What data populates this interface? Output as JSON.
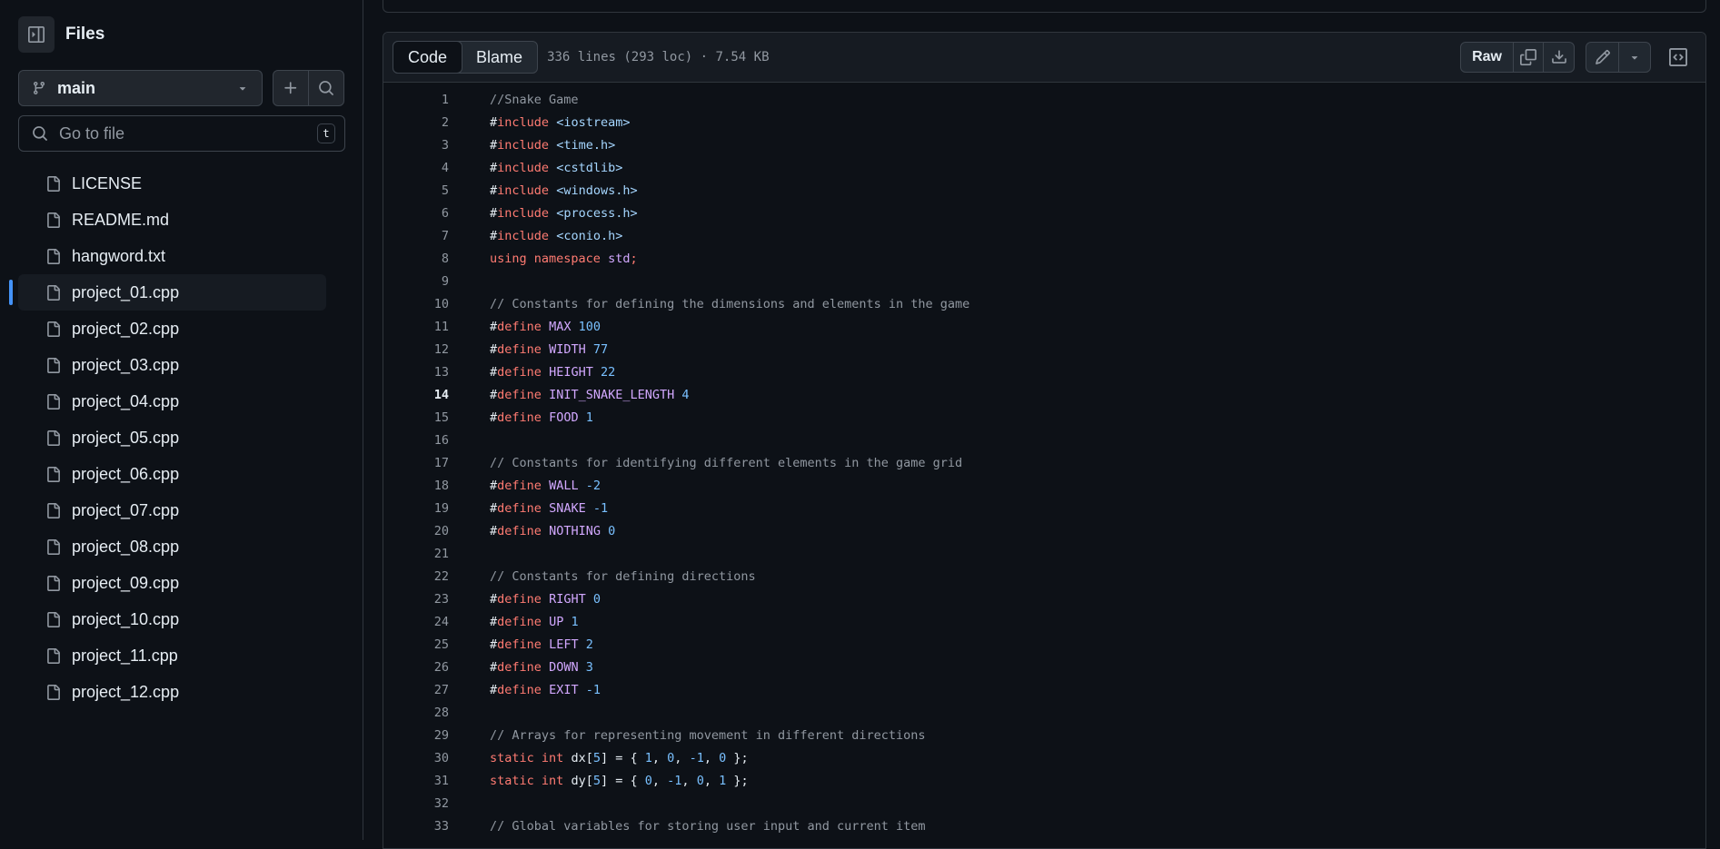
{
  "sidebar": {
    "title": "Files",
    "branch": "main",
    "search_placeholder": "Go to file",
    "search_shortcut": "t",
    "files": [
      {
        "name": "LICENSE",
        "active": false
      },
      {
        "name": "README.md",
        "active": false
      },
      {
        "name": "hangword.txt",
        "active": false
      },
      {
        "name": "project_01.cpp",
        "active": true
      },
      {
        "name": "project_02.cpp",
        "active": false
      },
      {
        "name": "project_03.cpp",
        "active": false
      },
      {
        "name": "project_04.cpp",
        "active": false
      },
      {
        "name": "project_05.cpp",
        "active": false
      },
      {
        "name": "project_06.cpp",
        "active": false
      },
      {
        "name": "project_07.cpp",
        "active": false
      },
      {
        "name": "project_08.cpp",
        "active": false
      },
      {
        "name": "project_09.cpp",
        "active": false
      },
      {
        "name": "project_10.cpp",
        "active": false
      },
      {
        "name": "project_11.cpp",
        "active": false
      },
      {
        "name": "project_12.cpp",
        "active": false
      }
    ]
  },
  "code_view": {
    "tabs": [
      {
        "label": "Code",
        "active": true
      },
      {
        "label": "Blame",
        "active": false
      }
    ],
    "file_meta": "336 lines (293 loc) · 7.54 KB",
    "raw_label": "Raw",
    "highlighted_line": 14,
    "lines": [
      [
        [
          "c",
          "//Snake Game"
        ]
      ],
      [
        [
          "t",
          "#"
        ],
        [
          "k",
          "include"
        ],
        [
          "t",
          " "
        ],
        [
          "s",
          "<iostream>"
        ]
      ],
      [
        [
          "t",
          "#"
        ],
        [
          "k",
          "include"
        ],
        [
          "t",
          " "
        ],
        [
          "s",
          "<time.h>"
        ]
      ],
      [
        [
          "t",
          "#"
        ],
        [
          "k",
          "include"
        ],
        [
          "t",
          " "
        ],
        [
          "s",
          "<cstdlib>"
        ]
      ],
      [
        [
          "t",
          "#"
        ],
        [
          "k",
          "include"
        ],
        [
          "t",
          " "
        ],
        [
          "s",
          "<windows.h>"
        ]
      ],
      [
        [
          "t",
          "#"
        ],
        [
          "k",
          "include"
        ],
        [
          "t",
          " "
        ],
        [
          "s",
          "<process.h>"
        ]
      ],
      [
        [
          "t",
          "#"
        ],
        [
          "k",
          "include"
        ],
        [
          "t",
          " "
        ],
        [
          "s",
          "<conio.h>"
        ]
      ],
      [
        [
          "k",
          "using"
        ],
        [
          "t",
          " "
        ],
        [
          "k",
          "namespace"
        ],
        [
          "t",
          " "
        ],
        [
          "m",
          "std"
        ],
        [
          "k",
          ";"
        ]
      ],
      [],
      [
        [
          "c",
          "// Constants for defining the dimensions and elements in the game"
        ]
      ],
      [
        [
          "t",
          "#"
        ],
        [
          "k",
          "define"
        ],
        [
          "t",
          " "
        ],
        [
          "m",
          "MAX"
        ],
        [
          "t",
          " "
        ],
        [
          "n",
          "100"
        ]
      ],
      [
        [
          "t",
          "#"
        ],
        [
          "k",
          "define"
        ],
        [
          "t",
          " "
        ],
        [
          "m",
          "WIDTH"
        ],
        [
          "t",
          " "
        ],
        [
          "n",
          "77"
        ]
      ],
      [
        [
          "t",
          "#"
        ],
        [
          "k",
          "define"
        ],
        [
          "t",
          " "
        ],
        [
          "m",
          "HEIGHT"
        ],
        [
          "t",
          " "
        ],
        [
          "n",
          "22"
        ]
      ],
      [
        [
          "t",
          "#"
        ],
        [
          "k",
          "define"
        ],
        [
          "t",
          " "
        ],
        [
          "m",
          "INIT_SNAKE_LENGTH"
        ],
        [
          "t",
          " "
        ],
        [
          "n",
          "4"
        ]
      ],
      [
        [
          "t",
          "#"
        ],
        [
          "k",
          "define"
        ],
        [
          "t",
          " "
        ],
        [
          "m",
          "FOOD"
        ],
        [
          "t",
          " "
        ],
        [
          "n",
          "1"
        ]
      ],
      [],
      [
        [
          "c",
          "// Constants for identifying different elements in the game grid"
        ]
      ],
      [
        [
          "t",
          "#"
        ],
        [
          "k",
          "define"
        ],
        [
          "t",
          " "
        ],
        [
          "m",
          "WALL"
        ],
        [
          "t",
          " "
        ],
        [
          "n",
          "-2"
        ]
      ],
      [
        [
          "t",
          "#"
        ],
        [
          "k",
          "define"
        ],
        [
          "t",
          " "
        ],
        [
          "m",
          "SNAKE"
        ],
        [
          "t",
          " "
        ],
        [
          "n",
          "-1"
        ]
      ],
      [
        [
          "t",
          "#"
        ],
        [
          "k",
          "define"
        ],
        [
          "t",
          " "
        ],
        [
          "m",
          "NOTHING"
        ],
        [
          "t",
          " "
        ],
        [
          "n",
          "0"
        ]
      ],
      [],
      [
        [
          "c",
          "// Constants for defining directions"
        ]
      ],
      [
        [
          "t",
          "#"
        ],
        [
          "k",
          "define"
        ],
        [
          "t",
          " "
        ],
        [
          "m",
          "RIGHT"
        ],
        [
          "t",
          " "
        ],
        [
          "n",
          "0"
        ]
      ],
      [
        [
          "t",
          "#"
        ],
        [
          "k",
          "define"
        ],
        [
          "t",
          " "
        ],
        [
          "m",
          "UP"
        ],
        [
          "t",
          " "
        ],
        [
          "n",
          "1"
        ]
      ],
      [
        [
          "t",
          "#"
        ],
        [
          "k",
          "define"
        ],
        [
          "t",
          " "
        ],
        [
          "m",
          "LEFT"
        ],
        [
          "t",
          " "
        ],
        [
          "n",
          "2"
        ]
      ],
      [
        [
          "t",
          "#"
        ],
        [
          "k",
          "define"
        ],
        [
          "t",
          " "
        ],
        [
          "m",
          "DOWN"
        ],
        [
          "t",
          " "
        ],
        [
          "n",
          "3"
        ]
      ],
      [
        [
          "t",
          "#"
        ],
        [
          "k",
          "define"
        ],
        [
          "t",
          " "
        ],
        [
          "m",
          "EXIT"
        ],
        [
          "t",
          " "
        ],
        [
          "n",
          "-1"
        ]
      ],
      [],
      [
        [
          "c",
          "// Arrays for representing movement in different directions"
        ]
      ],
      [
        [
          "k",
          "static"
        ],
        [
          "t",
          " "
        ],
        [
          "k",
          "int"
        ],
        [
          "t",
          " dx["
        ],
        [
          "n",
          "5"
        ],
        [
          "t",
          "] = { "
        ],
        [
          "n",
          "1"
        ],
        [
          "t",
          ", "
        ],
        [
          "n",
          "0"
        ],
        [
          "t",
          ", "
        ],
        [
          "n",
          "-1"
        ],
        [
          "t",
          ", "
        ],
        [
          "n",
          "0"
        ],
        [
          "t",
          " };"
        ]
      ],
      [
        [
          "k",
          "static"
        ],
        [
          "t",
          " "
        ],
        [
          "k",
          "int"
        ],
        [
          "t",
          " dy["
        ],
        [
          "n",
          "5"
        ],
        [
          "t",
          "] = { "
        ],
        [
          "n",
          "0"
        ],
        [
          "t",
          ", "
        ],
        [
          "n",
          "-1"
        ],
        [
          "t",
          ", "
        ],
        [
          "n",
          "0"
        ],
        [
          "t",
          ", "
        ],
        [
          "n",
          "1"
        ],
        [
          "t",
          " };"
        ]
      ],
      [],
      [
        [
          "c",
          "// Global variables for storing user input and current item"
        ]
      ]
    ]
  },
  "colors": {
    "background": "#0d1117",
    "panel": "#161b22",
    "accent": "#4493f8",
    "keyword": "#ff7b72",
    "string": "#a5d6ff",
    "macro": "#d2a8ff",
    "number": "#79c0ff",
    "comment": "#9198a1"
  }
}
